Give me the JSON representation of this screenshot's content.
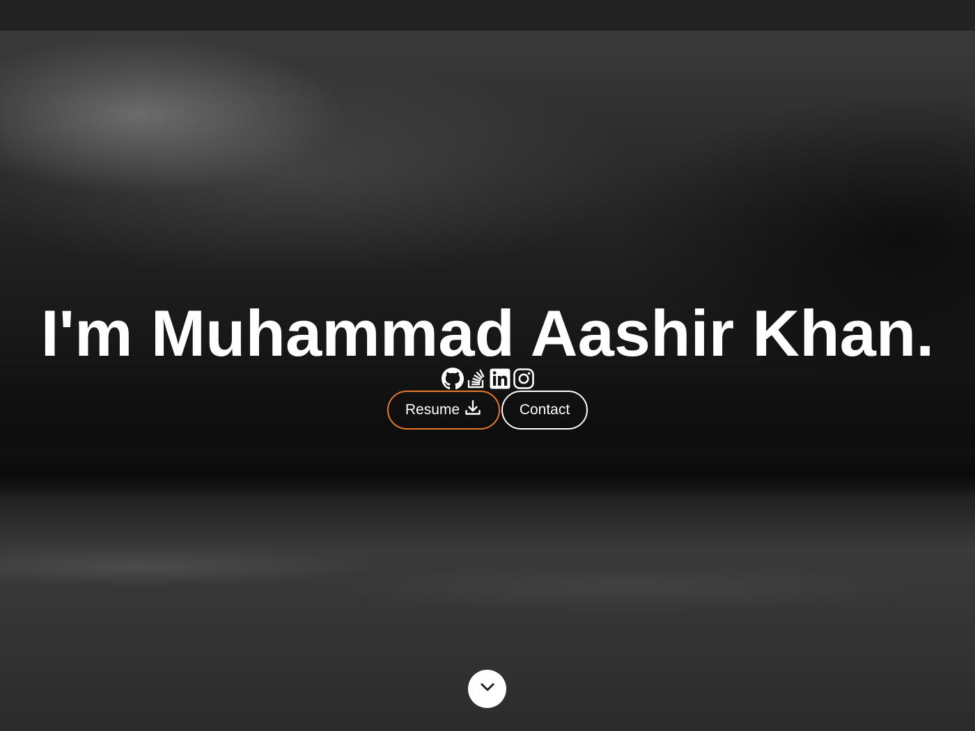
{
  "hero": {
    "headline": "I'm Muhammad Aashir Khan."
  },
  "socials": [
    {
      "name": "github",
      "icon": "github-icon"
    },
    {
      "name": "stackoverflow",
      "icon": "stackoverflow-icon"
    },
    {
      "name": "linkedin",
      "icon": "linkedin-icon"
    },
    {
      "name": "instagram",
      "icon": "instagram-icon"
    }
  ],
  "buttons": {
    "resume_label": "Resume",
    "resume_icon": "download-icon",
    "resume_border_color": "#e8782a",
    "contact_label": "Contact"
  },
  "scroll_down": {
    "icon": "chevron-down-icon"
  },
  "colors": {
    "accent": "#e8782a",
    "text": "#ffffff",
    "topbar": "#232323"
  }
}
